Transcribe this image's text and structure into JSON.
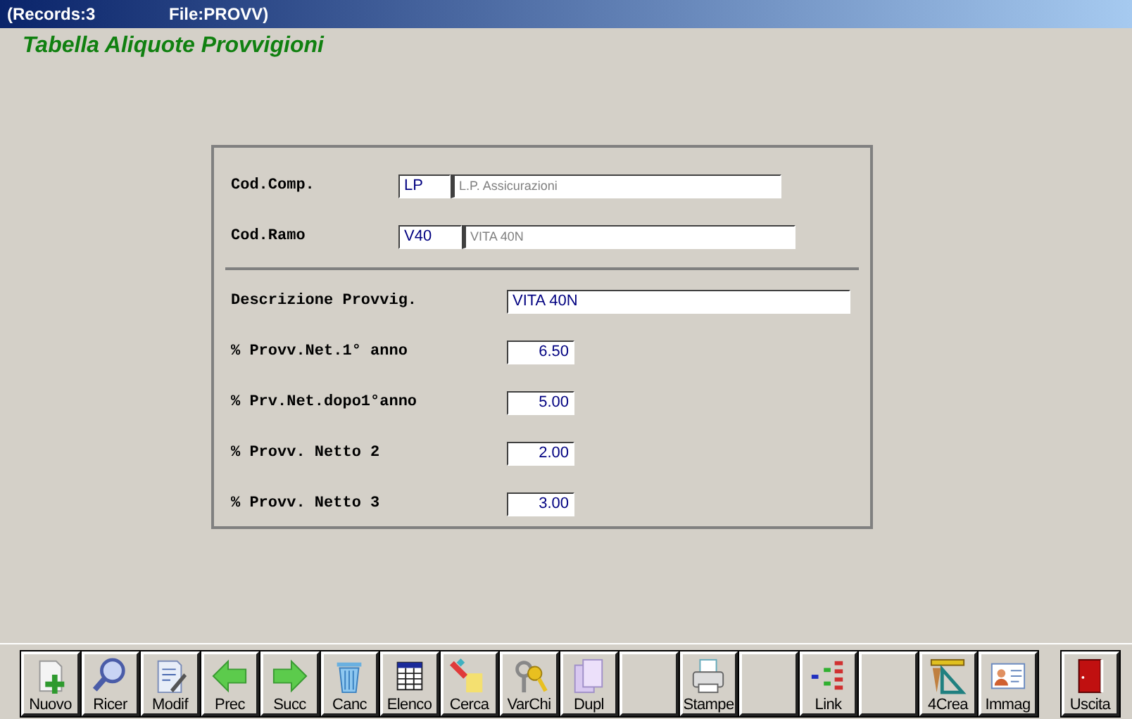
{
  "title_bar": {
    "records": "(Records:3",
    "file": "File:PROVV)"
  },
  "heading": "Tabella Aliquote Provvigioni",
  "lookups": [
    {
      "label": "Cod.Comp.",
      "code": "LP",
      "description": "L.P. Assicurazioni"
    },
    {
      "label": "Cod.Ramo",
      "code": "V40",
      "description": "VITA 40N"
    }
  ],
  "description_field": {
    "label": "Descrizione Provvig.",
    "value": "VITA 40N"
  },
  "rates": [
    {
      "label": "% Provv.Net.1° anno",
      "value": "6.50"
    },
    {
      "label": "% Prv.Net.dopo1°anno",
      "value": "5.00"
    },
    {
      "label": "% Provv. Netto 2",
      "value": "2.00"
    },
    {
      "label": "% Provv. Netto 3",
      "value": "3.00"
    }
  ],
  "toolbar": [
    {
      "kind": "command",
      "label": "Nuovo"
    },
    {
      "kind": "command",
      "label": "Ricer"
    },
    {
      "kind": "command",
      "label": "Modif"
    },
    {
      "kind": "command",
      "label": "Prec"
    },
    {
      "kind": "command",
      "label": "Succ"
    },
    {
      "kind": "command",
      "label": "Canc"
    },
    {
      "kind": "command",
      "label": "Elenco"
    },
    {
      "kind": "command",
      "label": "Cerca"
    },
    {
      "kind": "command",
      "label": "VarChi"
    },
    {
      "kind": "command",
      "label": "Dupl"
    },
    {
      "kind": "blank"
    },
    {
      "kind": "command",
      "label": "Stampe"
    },
    {
      "kind": "blank"
    },
    {
      "kind": "command",
      "label": "Link"
    },
    {
      "kind": "blank"
    },
    {
      "kind": "command",
      "label": "4Crea"
    },
    {
      "kind": "command",
      "label": "Immag"
    },
    {
      "kind": "exit",
      "label": "Uscita"
    }
  ]
}
